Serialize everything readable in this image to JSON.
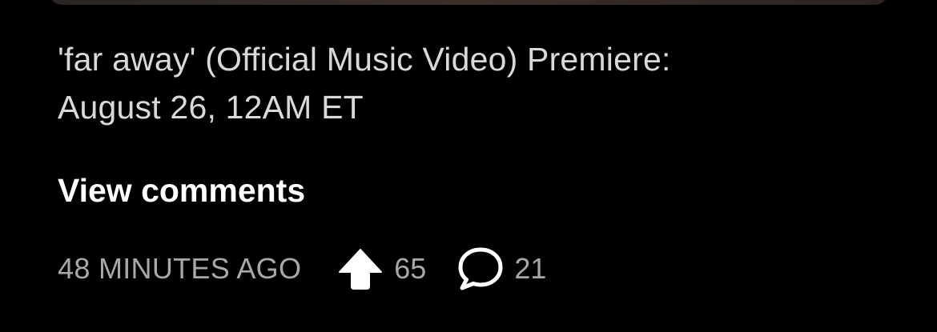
{
  "post": {
    "caption_line1": "'far away' (Official Music Video) Premiere:",
    "caption_line2": "August 26, 12AM ET",
    "view_comments_label": "View comments",
    "timestamp": "48 MINUTES AGO",
    "upvote_count": "65",
    "comment_count": "21"
  },
  "icons": {
    "upvote": "arrow-up-icon",
    "comment": "speech-bubble-icon"
  },
  "colors": {
    "background": "#000000",
    "caption_text": "#d9d9d9",
    "link_text": "#ffffff",
    "meta_text": "#a8a8a8",
    "icon_fill": "#ffffff"
  }
}
